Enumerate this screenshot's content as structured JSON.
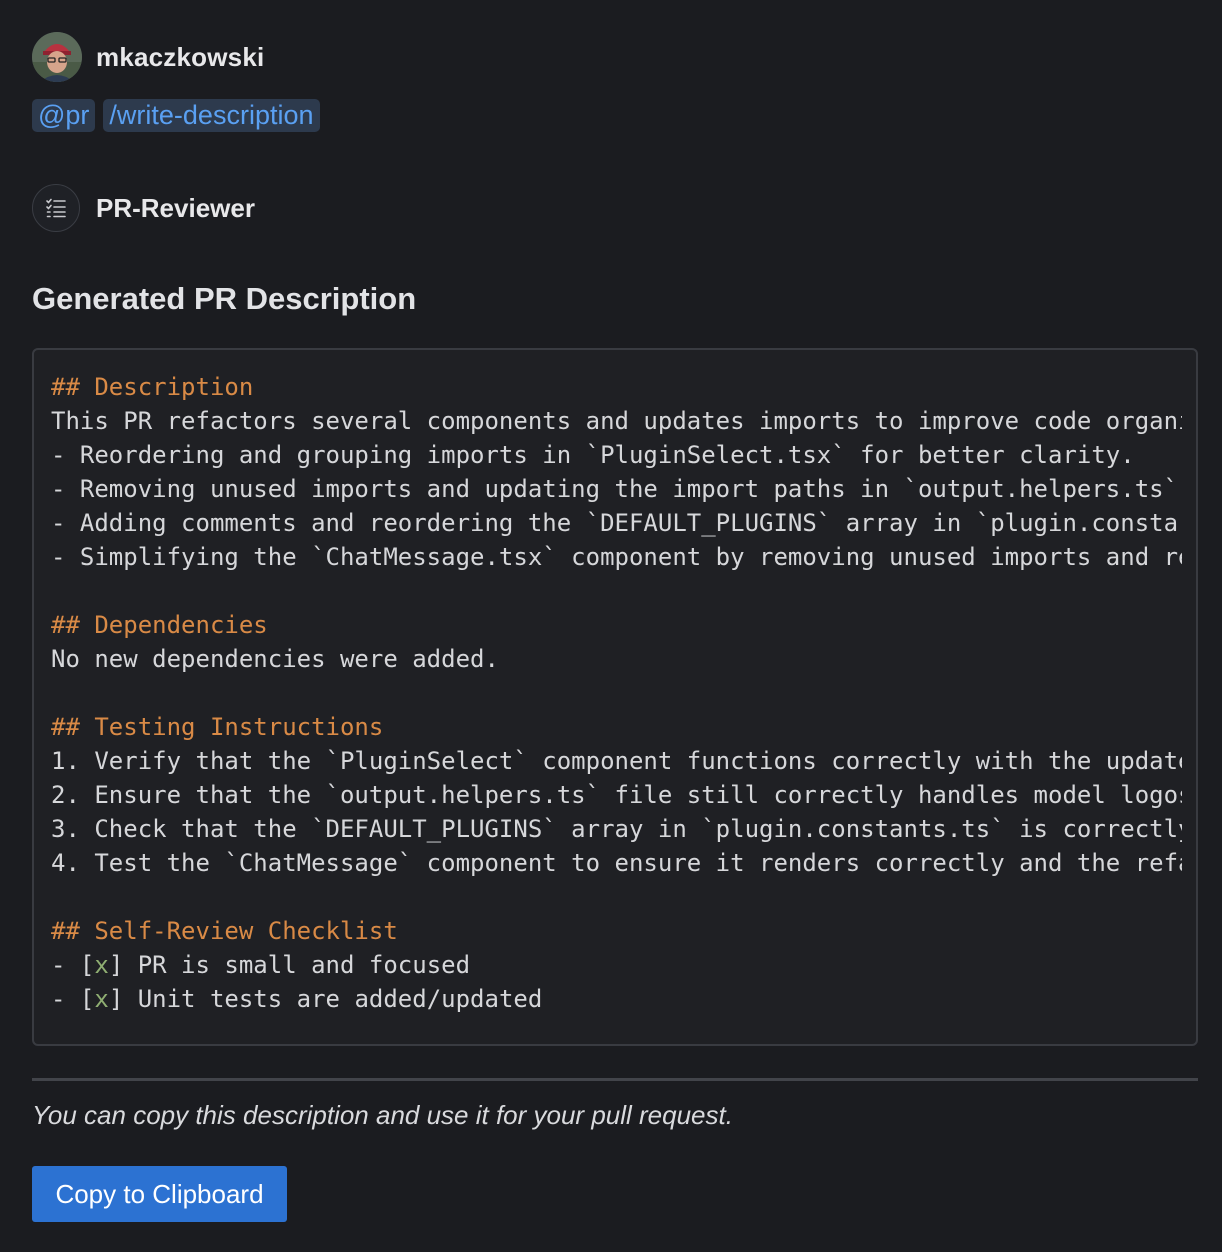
{
  "user": {
    "username": "mkaczkowski",
    "mentions": [
      "@pr",
      "/write-description"
    ]
  },
  "bot": {
    "name": "PR-Reviewer",
    "icon": "checklist-icon"
  },
  "section_title": "Generated PR Description",
  "code": {
    "heading_color": "#d98a46",
    "check_color": "#8fae72",
    "lines": [
      {
        "hdr": "## Description"
      },
      {
        "text": "This PR refactors several components and updates imports to improve code organi"
      },
      {
        "text": "- Reordering and grouping imports in `PluginSelect.tsx` for better clarity."
      },
      {
        "text": "- Removing unused imports and updating the import paths in `output.helpers.ts`."
      },
      {
        "text": "- Adding comments and reordering the `DEFAULT_PLUGINS` array in `plugin.constar"
      },
      {
        "text": "- Simplifying the `ChatMessage.tsx` component by removing unused imports and re"
      },
      {
        "text": ""
      },
      {
        "hdr": "## Dependencies"
      },
      {
        "text": "No new dependencies were added."
      },
      {
        "text": ""
      },
      {
        "hdr": "## Testing Instructions"
      },
      {
        "text": "1. Verify that the `PluginSelect` component functions correctly with the update"
      },
      {
        "text": "2. Ensure that the `output.helpers.ts` file still correctly handles model logos"
      },
      {
        "text": "3. Check that the `DEFAULT_PLUGINS` array in `plugin.constants.ts` is correctly"
      },
      {
        "text": "4. Test the `ChatMessage` component to ensure it renders correctly and the refa"
      },
      {
        "text": ""
      },
      {
        "hdr": "## Self-Review Checklist"
      },
      {
        "pre": "- [",
        "chk": "x",
        "post": "] PR is small and focused"
      },
      {
        "pre": "- [",
        "chk": "x",
        "post": "] Unit tests are added/updated"
      }
    ]
  },
  "note": "You can copy this description and use it for your pull request.",
  "copy_button": {
    "label": "Copy to Clipboard",
    "color": "#2c72d2"
  }
}
